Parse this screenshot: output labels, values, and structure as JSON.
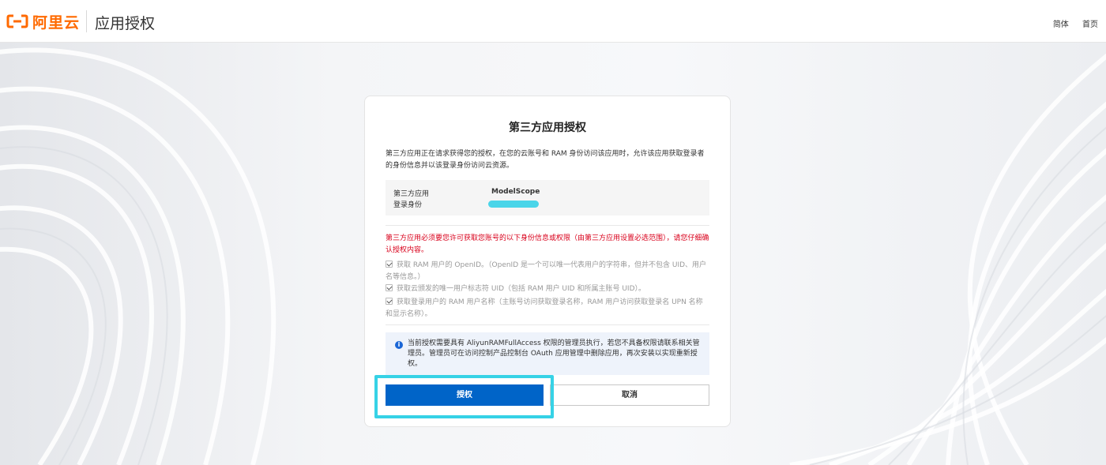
{
  "header": {
    "logo_text": "阿里云",
    "app_title": "应用授权",
    "lang_label": "简体",
    "home_label": "首页"
  },
  "card": {
    "title": "第三方应用授权",
    "description": "第三方应用正在请求获得您的授权，在您的云账号和 RAM 身份访问该应用时，允许该应用获取登录者的身份信息并以该登录身份访问云资源。",
    "info": {
      "app_label": "第三方应用",
      "app_value": "ModelScope",
      "identity_label": "登录身份"
    },
    "warning": "第三方应用必须要您许可获取您账号的以下身份信息或权限（由第三方应用设置必选范围），请您仔细确认授权内容。",
    "permissions": [
      "获取 RAM 用户的 OpenID。（OpenID 是一个可以唯一代表用户的字符串，但并不包含 UID、用户名等信息。）",
      "获取云颁发的唯一用户标志符 UID（包括 RAM 用户 UID 和所属主账号 UID）。",
      "获取登录用户的 RAM 用户名称（主账号访问获取登录名称，RAM 用户访问获取登录名 UPN 名称和显示名称）。"
    ],
    "notice": "当前授权需要具有 AliyunRAMFullAccess 权限的管理员执行，若您不具备权限请联系相关管理员。管理员可在访问控制产品控制台 OAuth 应用管理中删除应用，再次安装以实现重新授权。",
    "authorize_label": "授权",
    "cancel_label": "取消"
  },
  "colors": {
    "brand": "#ff6a00",
    "primary": "#0064c8",
    "warning": "#d9001b",
    "highlight": "#36d2e6"
  }
}
